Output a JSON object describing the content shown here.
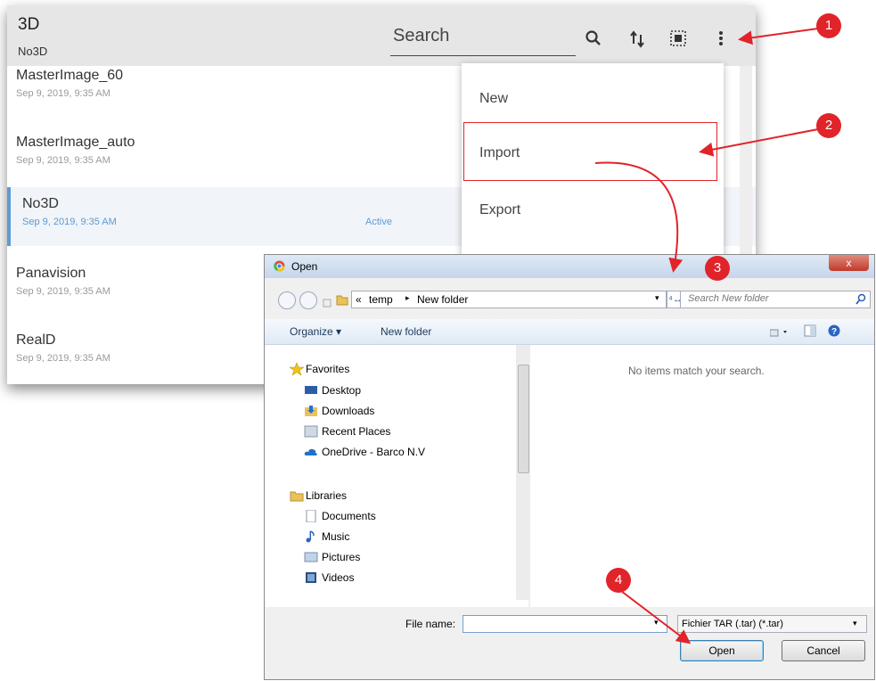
{
  "app": {
    "title": "3D",
    "subtitle": "No3D",
    "search_placeholder": "Search",
    "icons": [
      "search-icon",
      "sort-icon",
      "select-all-icon",
      "more-vert-icon"
    ]
  },
  "list": {
    "items": [
      {
        "name": "MasterImage_60",
        "date": "Sep 9, 2019, 9:35 AM"
      },
      {
        "name": "MasterImage_auto",
        "date": "Sep 9, 2019, 9:35 AM"
      },
      {
        "name": "No3D",
        "date": "Sep 9, 2019, 9:35 AM",
        "badge": "Active"
      },
      {
        "name": "Panavision",
        "date": "Sep 9, 2019, 9:35 AM"
      },
      {
        "name": "RealD",
        "date": "Sep 9, 2019, 9:35 AM"
      }
    ]
  },
  "menu": {
    "items": [
      "New",
      "Import",
      "Export"
    ]
  },
  "dialog": {
    "title": "Open",
    "close": "x",
    "address": {
      "prefix": "«",
      "path": [
        "temp",
        "New folder"
      ]
    },
    "search_placeholder": "Search New folder",
    "toolbar": {
      "organize": "Organize ▾",
      "new_folder": "New folder"
    },
    "nav": {
      "favorites_header": "Favorites",
      "favorites": [
        "Desktop",
        "Downloads",
        "Recent Places",
        "OneDrive - Barco N.V"
      ],
      "libraries_header": "Libraries",
      "libraries": [
        "Documents",
        "Music",
        "Pictures",
        "Videos"
      ]
    },
    "empty_message": "No items match your search.",
    "file_name_label": "File name:",
    "file_name_value": "",
    "file_type": "Fichier TAR (.tar) (*.tar)",
    "open_button": "Open",
    "cancel_button": "Cancel"
  },
  "callouts": [
    "1",
    "2",
    "3",
    "4"
  ],
  "colors": {
    "callout_red": "#e0242a",
    "active_blue": "#5b9bd5",
    "header_gray": "#e6e6e6"
  }
}
